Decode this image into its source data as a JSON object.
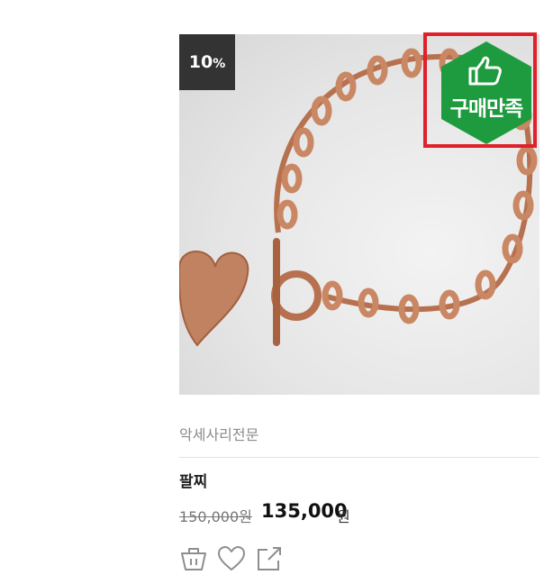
{
  "product": {
    "discount_value": "10",
    "discount_unit": "%",
    "satisfaction_badge": "구매만족",
    "seller": "악세사리전문",
    "name": "팔찌",
    "original_price": "150,000원",
    "sale_price": "135,000",
    "sale_currency": "원"
  },
  "colors": {
    "badge_dark": "#333333",
    "badge_green": "#1e9b3f",
    "highlight_red": "#e0202a",
    "rose_gold": "#b7714f"
  },
  "actions": [
    {
      "icon": "cart-basket-icon"
    },
    {
      "icon": "heart-icon"
    },
    {
      "icon": "share-icon"
    }
  ]
}
